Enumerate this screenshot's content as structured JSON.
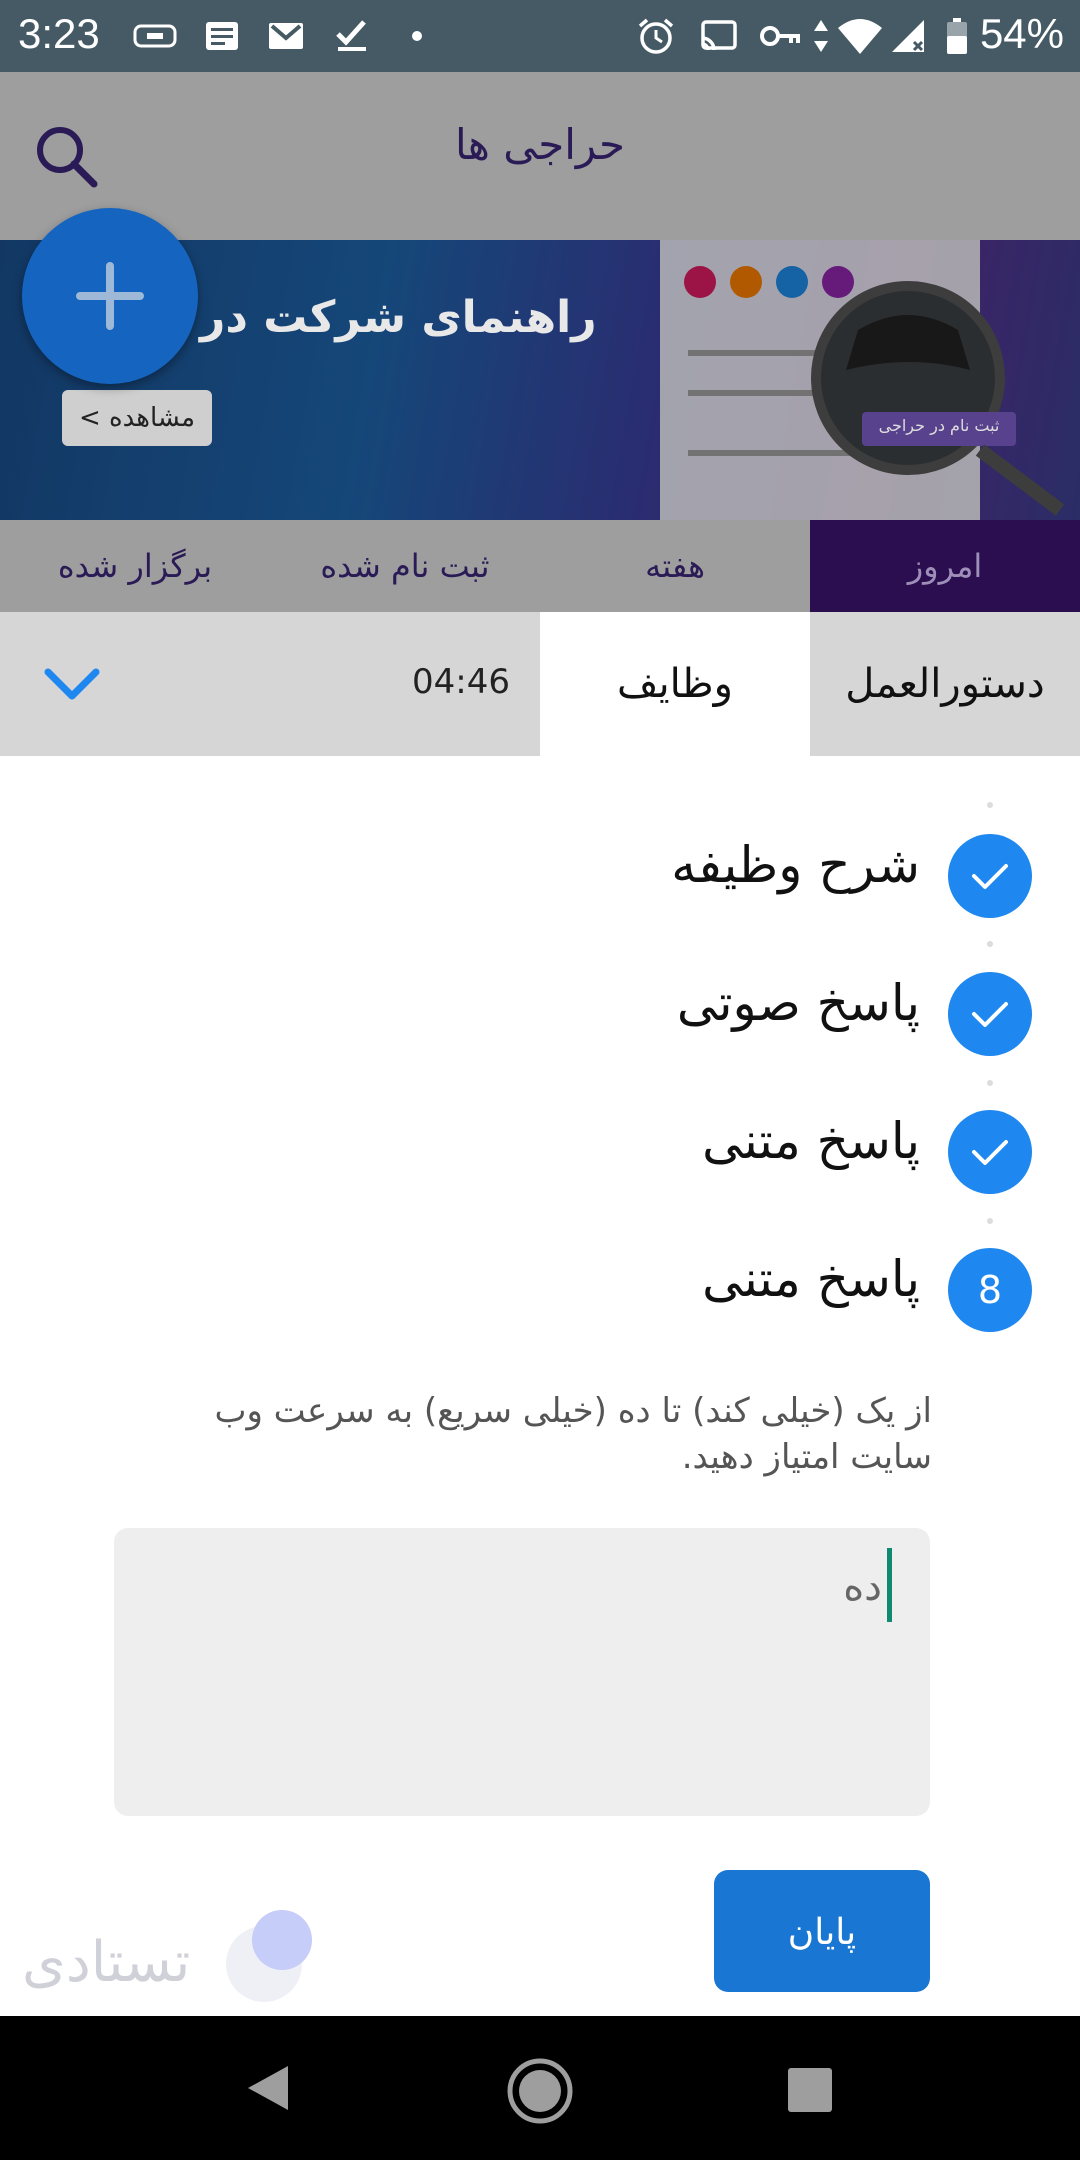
{
  "status_bar": {
    "time": "3:23",
    "battery": "54%",
    "icons": [
      "cardboard-icon",
      "news-icon",
      "gmail-icon",
      "tasks-icon",
      "dot-icon",
      "alarm-icon",
      "cast-icon",
      "vpn-key-icon",
      "data-arrows-icon",
      "wifi-icon",
      "signal-icon",
      "battery-icon"
    ]
  },
  "app_bar": {
    "title": "حراجی ها"
  },
  "banner": {
    "heading": "راهنمای شرکت در",
    "view_button": "مشاهده",
    "register_label": "ثبت نام در حراجی"
  },
  "category_tabs": [
    {
      "label": "امروز",
      "selected": true
    },
    {
      "label": "هفته",
      "selected": false
    },
    {
      "label": "ثبت نام شده",
      "selected": false
    },
    {
      "label": "برگزار شده",
      "selected": false
    }
  ],
  "sheet": {
    "tabs": [
      {
        "label": "دستورالعمل",
        "selected": false
      },
      {
        "label": "وظایف",
        "selected": true
      }
    ],
    "timer": "04:46",
    "steps": [
      {
        "label": "شرح وظیفه",
        "state": "done"
      },
      {
        "label": "پاسخ صوتی",
        "state": "done"
      },
      {
        "label": "پاسخ متنی",
        "state": "done"
      },
      {
        "label": "پاسخ متنی",
        "state": "current",
        "number": "8"
      }
    ],
    "question": "از یک (خیلی کند) تا ده (خیلی سریع) به سرعت وب سایت امتیاز دهید.",
    "answer_value": "ده",
    "finish_button": "پایان",
    "logo_text": "تستادی"
  },
  "colors": {
    "accent": "#1e88f0",
    "finish": "#1976d2",
    "selected_tab": "#2a0e4f",
    "caret": "#0f8a70"
  }
}
